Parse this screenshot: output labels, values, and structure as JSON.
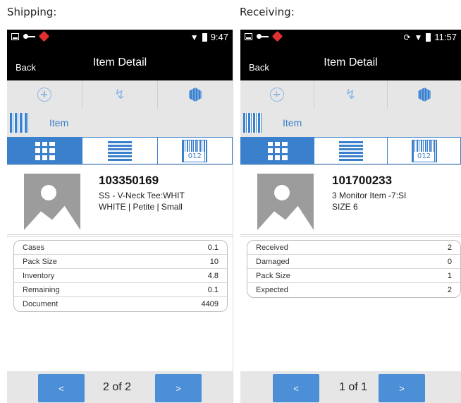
{
  "captions": {
    "left": "Shipping:",
    "right": "Receiving:"
  },
  "phones": [
    {
      "status_time": "9:47",
      "back_label": "Back",
      "title": "Item Detail",
      "item_label": "Item",
      "barcode_tab_text": "012",
      "item_code": "103350169",
      "item_desc": "SS - V-Neck Tee:WHIT",
      "item_attrs": "WHITE | Petite | Small",
      "rows": [
        {
          "label": "Cases",
          "value": "0.1"
        },
        {
          "label": "Pack Size",
          "value": "10"
        },
        {
          "label": "Inventory",
          "value": "4.8"
        },
        {
          "label": "Remaining",
          "value": "0.1"
        },
        {
          "label": "Document",
          "value": "4409"
        }
      ],
      "prev_label": "<",
      "next_label": ">",
      "pager": "2 of 2"
    },
    {
      "status_time": "11:57",
      "back_label": "Back",
      "title": "Item Detail",
      "item_label": "Item",
      "barcode_tab_text": "012",
      "item_code": "101700233",
      "item_desc": "3 Monitor Item -7:SI",
      "item_attrs": "SIZE 6",
      "rows": [
        {
          "label": "Received",
          "value": "2"
        },
        {
          "label": "Damaged",
          "value": "0"
        },
        {
          "label": "Pack Size",
          "value": "1"
        },
        {
          "label": "Expected",
          "value": "2"
        }
      ],
      "prev_label": "<",
      "next_label": ">",
      "pager": "1 of 1"
    }
  ],
  "icons": {
    "status": [
      "screen-icon",
      "key-icon",
      "alert-icon",
      "wifi-icon",
      "battery-icon",
      "rotate-icon"
    ],
    "actions": [
      "add-circle-icon",
      "lightning-icon",
      "cube-icon"
    ],
    "tabs": [
      "grid-icon",
      "list-icon",
      "barcode-icon"
    ]
  },
  "colors": {
    "accent": "#3b80cc",
    "button": "#4d8fd6",
    "bar_bg": "#000000",
    "toolbar_bg": "#e6e6e6"
  }
}
